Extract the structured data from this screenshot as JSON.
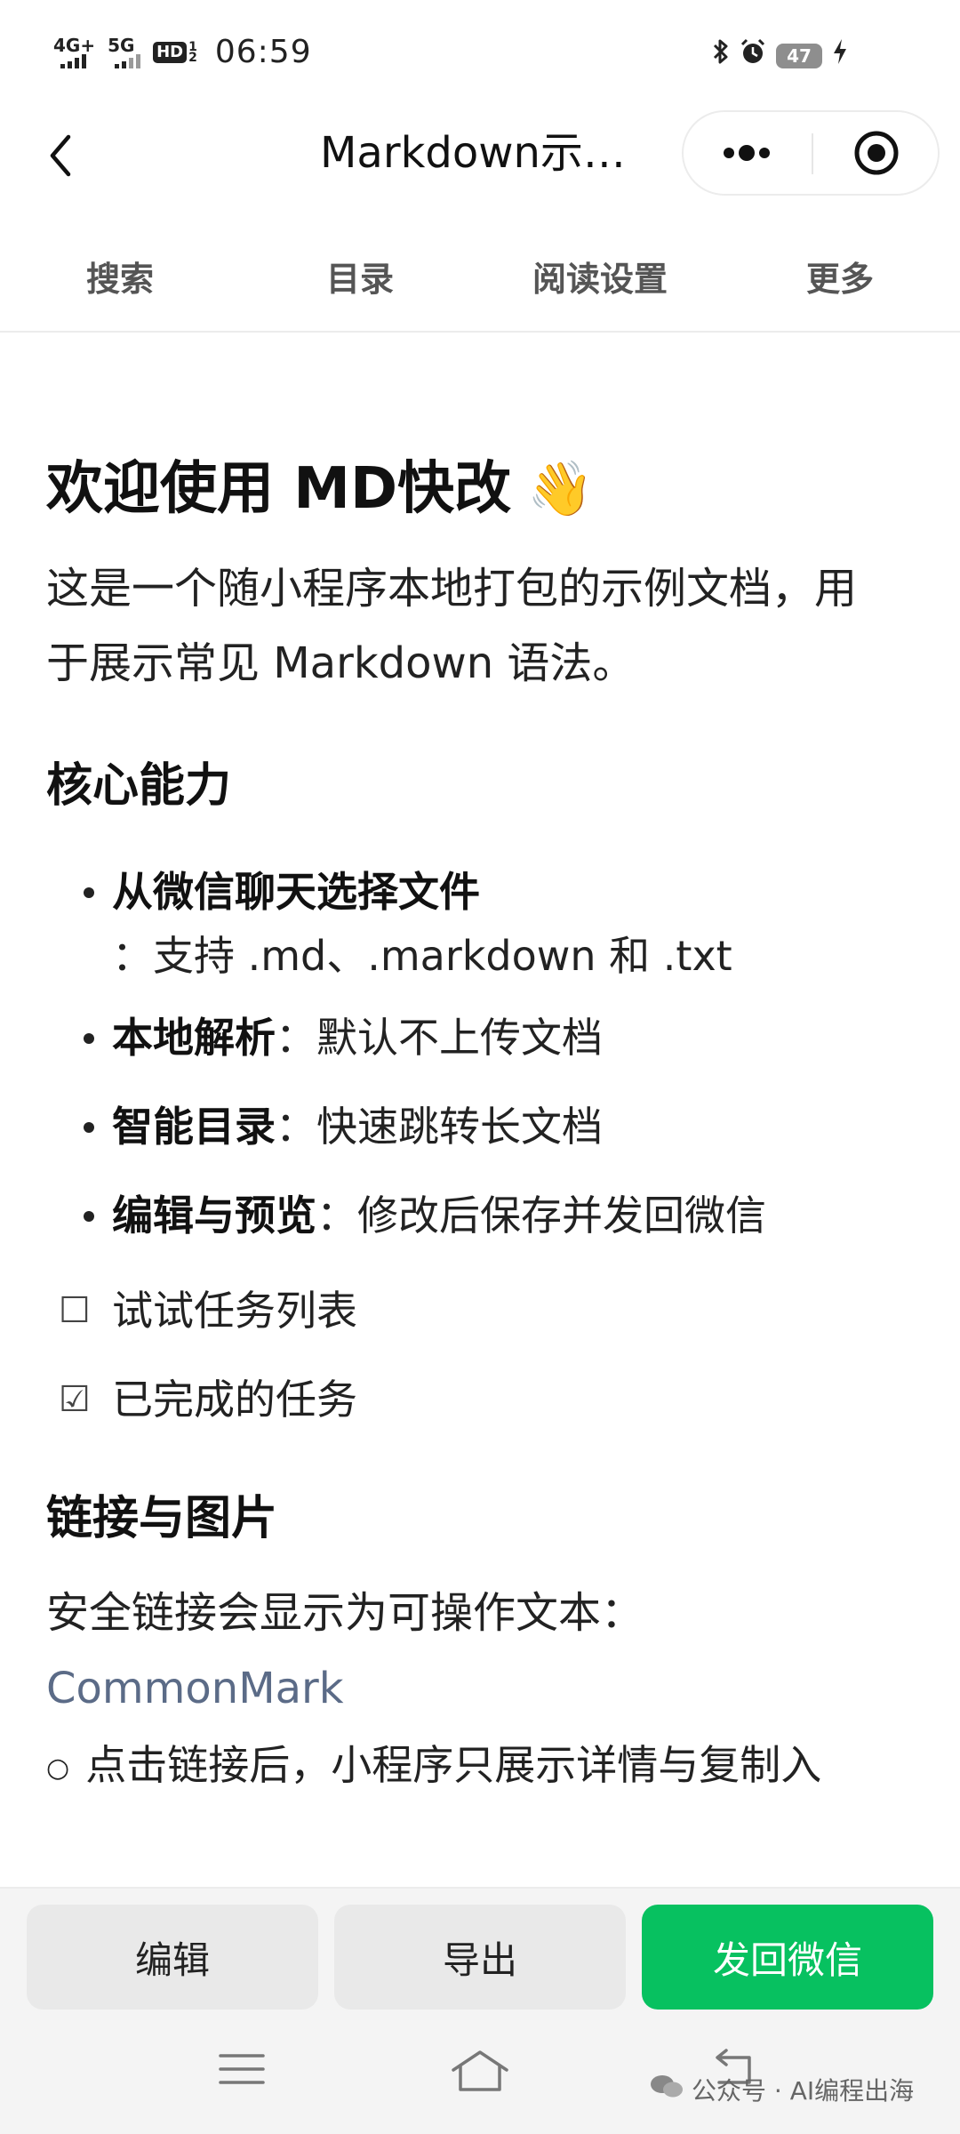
{
  "status_bar": {
    "net1": "4G+",
    "net2": "5G",
    "hd": "HD",
    "hd_sub_top": "1",
    "hd_sub_bottom": "2",
    "time": "06:59",
    "battery": "47"
  },
  "nav": {
    "title": "Markdown示…"
  },
  "toolbar": {
    "tabs": [
      "搜索",
      "目录",
      "阅读设置",
      "更多"
    ]
  },
  "doc": {
    "h1": "欢迎使用 MD快改",
    "h1_emoji": "👋",
    "intro_line1": "这是一个随小程序本地打包的示例文档，用",
    "intro_line2": "于展示常见 Markdown 语法。",
    "section1_title": "核心能力",
    "bullets": [
      {
        "bold": "从微信聊天选择文件",
        "text": "：支持 .md、.markdown 和 .txt"
      },
      {
        "bold": "本地解析",
        "text": "：默认不上传文档"
      },
      {
        "bold": "智能目录",
        "text": "：快速跳转长文档"
      },
      {
        "bold": "编辑与预览",
        "text": "：修改后保存并发回微信"
      }
    ],
    "tasks": [
      {
        "checked": false,
        "text": "试试任务列表"
      },
      {
        "checked": true,
        "text": "已完成的任务"
      }
    ],
    "section2_title": "链接与图片",
    "links_para": "安全链接会显示为可操作文本：",
    "link_label": "CommonMark",
    "cut_line": "点击链接后，小程序只展示详情与复制入"
  },
  "actions": {
    "edit": "编辑",
    "export": "导出",
    "send_back": "发回微信"
  },
  "watermark": "公众号 · AI编程出海",
  "colors": {
    "primary_green": "#07c160",
    "link": "#5b6b87"
  }
}
